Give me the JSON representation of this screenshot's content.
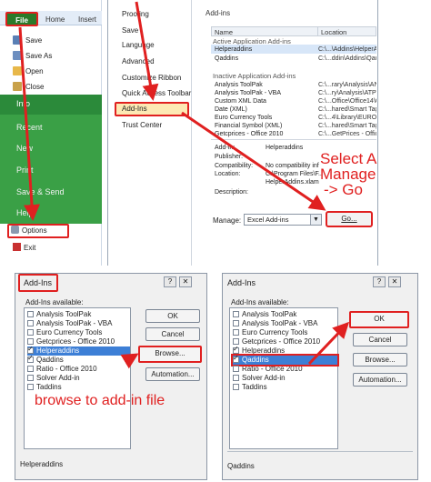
{
  "ribbon": {
    "file_label": "File",
    "tabs": [
      "Home",
      "Insert"
    ]
  },
  "backstage": {
    "items": [
      "Save",
      "Save As",
      "Open",
      "Close"
    ],
    "info": "Info",
    "side_items": [
      "Recent",
      "New",
      "Print",
      "Save & Send",
      "Help"
    ],
    "options": "Options",
    "exit": "Exit"
  },
  "options_nav": {
    "items": [
      "Proofing",
      "Save",
      "Language",
      "Advanced",
      "Customize Ribbon",
      "Quick Access Toolbar"
    ],
    "addins": "Add-Ins",
    "trust": "Trust Center"
  },
  "addins_pane": {
    "title": "Add-ins",
    "columns": [
      "Name",
      "Location"
    ],
    "active_header": "Active Application Add-ins",
    "active": [
      {
        "name": "Helperaddins",
        "location": "C:\\...\\Addins\\HelperA"
      },
      {
        "name": "Qaddins",
        "location": "C:\\...ddin\\Addins\\Qaddin"
      }
    ],
    "inactive_header": "Inactive Application Add-ins",
    "inactive": [
      {
        "name": "Analysis ToolPak",
        "location": "C:\\...rary\\Analysis\\ANA"
      },
      {
        "name": "Analysis ToolPak - VBA",
        "location": "C:\\...ry\\Analysis\\ATPVE"
      },
      {
        "name": "Custom XML Data",
        "location": "C:\\...Office\\Office14\\OF"
      },
      {
        "name": "Date (XML)",
        "location": "C:\\...hared\\Smart Tag\\"
      },
      {
        "name": "Euro Currency Tools",
        "location": "C:\\...4\\Library\\EUROTO"
      },
      {
        "name": "Financial Symbol (XML)",
        "location": "C:\\...hared\\Smart Tag\\"
      },
      {
        "name": "Getcprices - Office 2010",
        "location": "C:\\...GetPrices - Office 20"
      }
    ],
    "details": [
      {
        "label": "Add-in:",
        "value": "Helperaddins"
      },
      {
        "label": "Publisher:",
        "value": ""
      },
      {
        "label": "Compatibility:",
        "value": "No compatibility inf"
      },
      {
        "label": "Location:",
        "value": "C:\\Program Files\\F...HP-5.3.9\\www\\F"
      },
      {
        "label": "",
        "value": "HelperAddins.xlam"
      },
      {
        "label": "Description:",
        "value": ""
      }
    ],
    "manage_label": "Manage:",
    "manage_value": "Excel Add-ins",
    "go": "Go...",
    "callout": [
      "Select A",
      "Manage",
      "-> Go"
    ]
  },
  "dialog_left": {
    "title": "Add-Ins",
    "available_label": "Add-Ins available:",
    "items": [
      {
        "name": "Analysis ToolPak",
        "checked": false
      },
      {
        "name": "Analysis ToolPak - VBA",
        "checked": false
      },
      {
        "name": "Euro Currency Tools",
        "checked": false
      },
      {
        "name": "Getcprices - Office 2010",
        "checked": false
      },
      {
        "name": "Helperaddins",
        "checked": true
      },
      {
        "name": "Qaddins",
        "checked": true
      },
      {
        "name": "Ratio - Office 2010",
        "checked": false
      },
      {
        "name": "Solver Add-in",
        "checked": false
      },
      {
        "name": "Taddins",
        "checked": false
      }
    ],
    "selected_index": 4,
    "buttons": [
      "OK",
      "Cancel",
      "Browse...",
      "Automation..."
    ],
    "description_title": "Helperaddins",
    "callout": "browse to add-in file"
  },
  "dialog_right": {
    "title": "Add-Ins",
    "available_label": "Add-Ins available:",
    "items": [
      {
        "name": "Analysis ToolPak",
        "checked": false
      },
      {
        "name": "Analysis ToolPak - VBA",
        "checked": false
      },
      {
        "name": "Euro Currency Tools",
        "checked": false
      },
      {
        "name": "Getcprices - Office 2010",
        "checked": false
      },
      {
        "name": "Helperaddins",
        "checked": true
      },
      {
        "name": "Qaddins",
        "checked": true
      },
      {
        "name": "Ratio - Office 2010",
        "checked": false
      },
      {
        "name": "Solver Add-in",
        "checked": false
      },
      {
        "name": "Taddins",
        "checked": false
      }
    ],
    "selected_index": 5,
    "buttons": [
      "OK",
      "Cancel",
      "Browse...",
      "Automation..."
    ],
    "description_title": "Qaddins"
  },
  "colors": {
    "callout_red": "#e02020",
    "backstage_green": "#3aa046",
    "selection_blue": "#3d7fd6"
  }
}
